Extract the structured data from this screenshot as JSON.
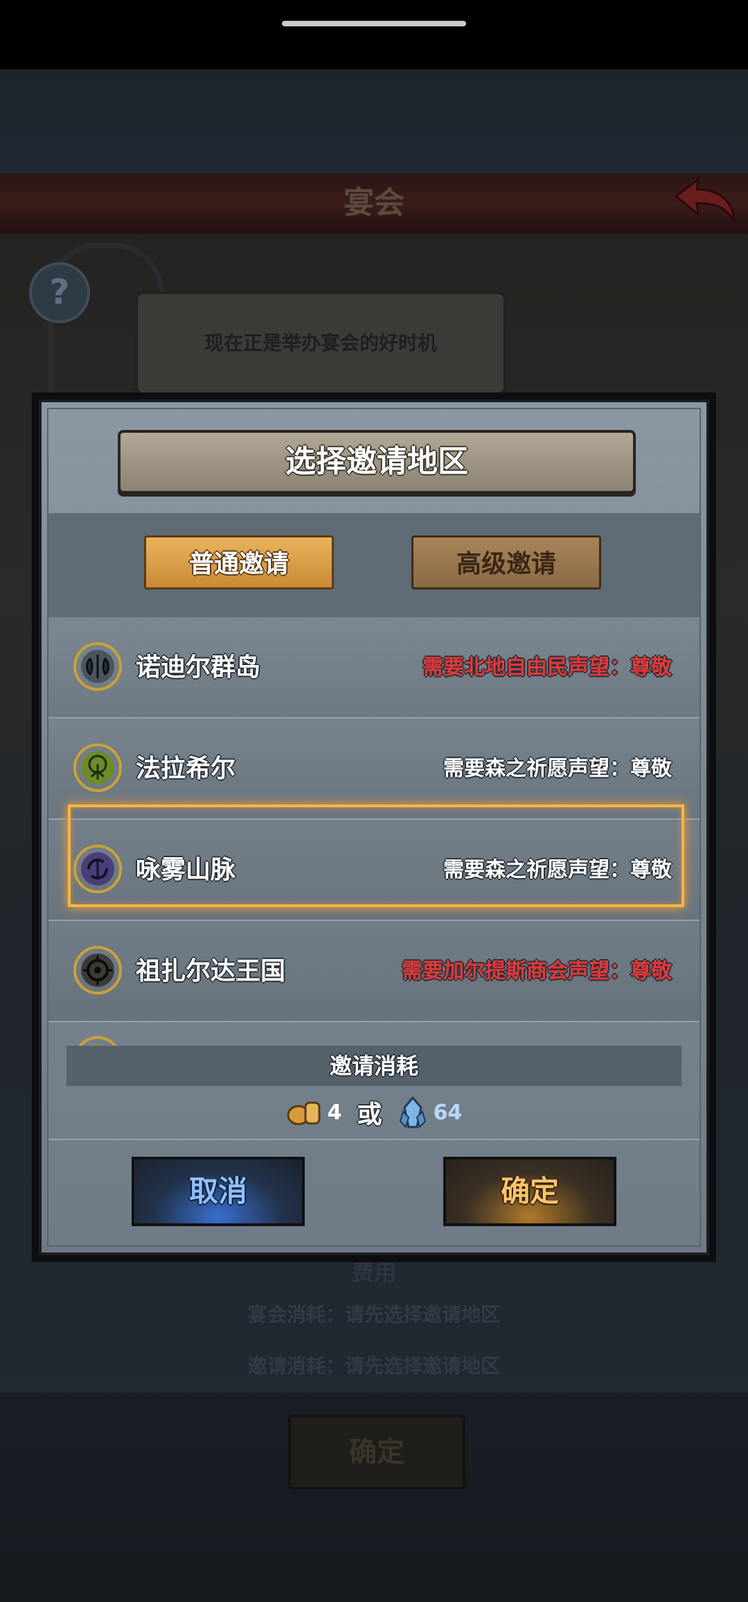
{
  "background": {
    "title": "宴会",
    "speech": "现在正是举办宴会的好时机",
    "help_glyph": "?",
    "cost_title": "费用",
    "banquet_cost": "宴会消耗：请先选择邀请地区",
    "invite_cost": "邀请消耗：请先选择邀请地区",
    "confirm": "确定"
  },
  "dialog": {
    "title": "选择邀请地区",
    "tabs": [
      {
        "label": "普通邀请",
        "active": true
      },
      {
        "label": "高级邀请",
        "active": false
      }
    ],
    "regions": [
      {
        "name": "诺迪尔群岛",
        "requirement": "需要北地自由民声望：尊敬",
        "req_color": "#e0393b",
        "icon": "axe-emblem-icon",
        "emblem_color": "#4a5560"
      },
      {
        "name": "法拉希尔",
        "requirement": "需要森之祈愿声望：尊敬",
        "req_color": "#ffffff",
        "icon": "tree-emblem-icon",
        "emblem_color": "#6f8a2a"
      },
      {
        "name": "咏雾山脉",
        "requirement": "需要森之祈愿声望：尊敬",
        "req_color": "#ffffff",
        "icon": "swirl-emblem-icon",
        "emblem_color": "#4a3f78",
        "selected": true
      },
      {
        "name": "祖扎尔达王国",
        "requirement": "需要加尔提斯商会声望：尊敬",
        "req_color": "#e0393b",
        "icon": "sun-emblem-icon",
        "emblem_color": "#3b3a36"
      }
    ],
    "cost_title": "邀请消耗",
    "cost_bread": "4",
    "cost_or": "或",
    "cost_crystal": "64",
    "cancel": "取消",
    "confirm": "确定"
  }
}
